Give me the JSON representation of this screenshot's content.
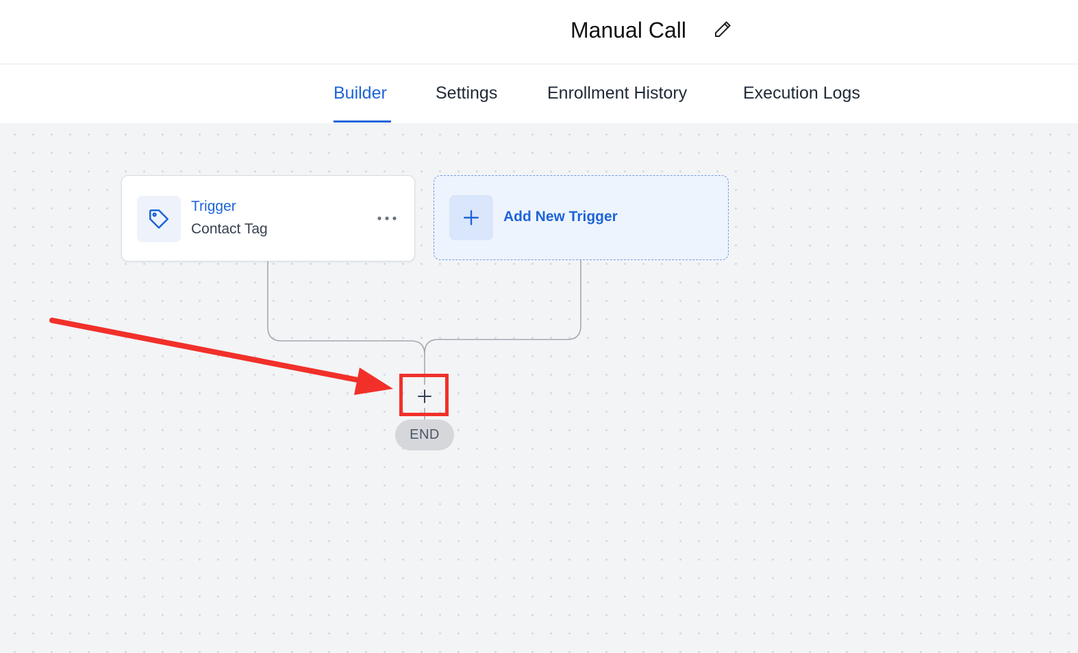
{
  "header": {
    "title": "Manual Call",
    "edit_icon": "pencil-icon"
  },
  "tabs": [
    {
      "label": "Builder",
      "active": true
    },
    {
      "label": "Settings",
      "active": false
    },
    {
      "label": "Enrollment History",
      "active": false
    },
    {
      "label": "Execution Logs",
      "active": false
    }
  ],
  "workflow": {
    "trigger": {
      "label": "Trigger",
      "subtitle": "Contact Tag",
      "icon": "tag-icon",
      "menu_icon": "more-horizontal-icon"
    },
    "add_trigger": {
      "label": "Add New Trigger",
      "icon": "plus-icon"
    },
    "add_step_icon": "plus-icon",
    "end_label": "END"
  },
  "annotation": {
    "color": "#f1302a",
    "target": "add-step-button"
  },
  "colors": {
    "accent": "#1d64d8",
    "canvas": "#f3f4f6",
    "connector": "#9ca3af"
  }
}
